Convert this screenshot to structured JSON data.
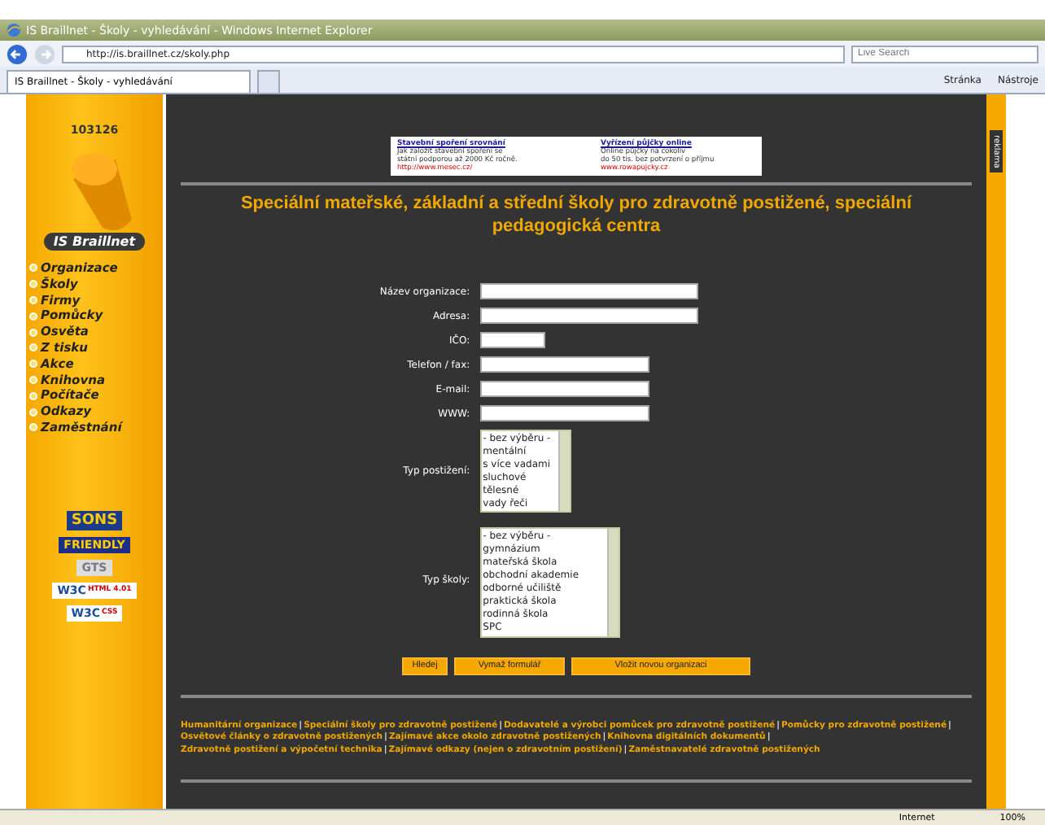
{
  "window": {
    "title": "IS Braillnet - Školy - vyhledávání - Windows Internet Explorer"
  },
  "address_bar": {
    "url": "http://is.braillnet.cz/skoly.php",
    "search_placeholder": "Live Search"
  },
  "tabs": [
    {
      "label": "IS Braillnet - Školy - vyhledávání",
      "selected": true
    }
  ],
  "command_bar": [
    "Stránka",
    "Nástroje"
  ],
  "sidebar": {
    "counter": "103126",
    "logo": "IS Braillnet",
    "items": [
      {
        "label": "Organizace"
      },
      {
        "label": "Školy"
      },
      {
        "label": "Firmy"
      },
      {
        "label": "Pomůcky"
      },
      {
        "label": "Osvěta"
      },
      {
        "label": "Z tisku"
      },
      {
        "label": "Akce"
      },
      {
        "label": "Knihovna"
      },
      {
        "label": "Počítače"
      },
      {
        "label": "Odkazy"
      },
      {
        "label": "Zaměstnání"
      }
    ],
    "badges": [
      {
        "kind": "sons",
        "label": "SONS"
      },
      {
        "kind": "friendly",
        "label": "FRIENDLY"
      },
      {
        "kind": "gts",
        "label": "GTS"
      },
      {
        "kind": "w3c",
        "label": "W3C",
        "sub": "HTML 4.01"
      },
      {
        "kind": "w3c",
        "label": "W3C",
        "sub": "CSS"
      }
    ]
  },
  "ads": [
    {
      "title": "Stavební spoření srovnání",
      "lines": [
        "Jak založit stavební spoření se",
        "státní podporou až 2000 Kč ročně."
      ],
      "url": "http://www.mesec.cz/"
    },
    {
      "title": "Vyřízení půjčky online",
      "lines": [
        "Online půjčky na cokoliv",
        "do 50 tis. bez potvrzení o příjmu"
      ],
      "url": "www.rowapujcky.cz"
    }
  ],
  "side_tab": "reklama",
  "heading": "Speciální mateřské, základní a střední školy pro zdravotně postižené, speciální pedagogická centra",
  "form": {
    "fields": [
      {
        "kind": "text",
        "label": "Název organizace:"
      },
      {
        "kind": "text",
        "label": "Adresa:"
      },
      {
        "kind": "text",
        "label": "IČO:"
      },
      {
        "kind": "text",
        "label": "Telefon / fax:"
      },
      {
        "kind": "text",
        "label": "E-mail:"
      },
      {
        "kind": "text",
        "label": "WWW:"
      },
      {
        "kind": "list",
        "label": "Typ postižení:",
        "options": [
          "- bez výběru -",
          "mentální",
          "s více vadami",
          "sluchové",
          "tělesné",
          "vady řeči"
        ]
      },
      {
        "kind": "list",
        "label": "Typ školy:",
        "options": [
          "- bez výběru -",
          "gymnázium",
          "mateřská škola",
          "obchodní akademie",
          "odborné učiliště",
          "praktická škola",
          "rodinná škola",
          "SPC"
        ]
      }
    ],
    "buttons": [
      "Hledej",
      "Vymaž formulář",
      "Vložit novou organizaci"
    ]
  },
  "footer_links": {
    "separator": "|",
    "links": [
      "Humanitární organizace",
      "Speciální školy pro zdravotně postižené",
      "Dodavatelé a výrobci pomůcek pro zdravotně postižené",
      "Pomůcky pro zdravotně postižené",
      "Osvětové články o zdravotně postižených",
      "Zajímavé akce okolo zdravotně postižených",
      "Knihovna digitálních dokumentů",
      "Zdravotně postižení a výpočetní technika",
      "Zajímavé odkazy (nejen o zdravotním postižení)",
      "Zaměstnavatelé zdravotně postižených"
    ]
  },
  "status_bar": {
    "zone": "Internet",
    "zoom": "100%"
  }
}
